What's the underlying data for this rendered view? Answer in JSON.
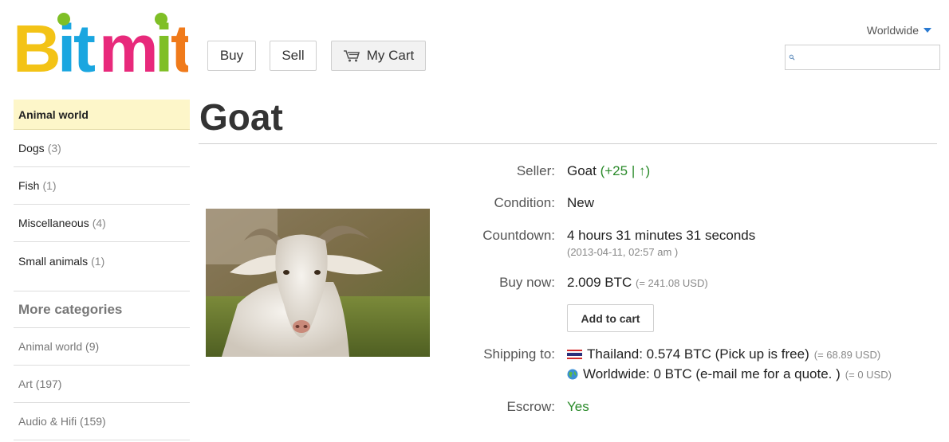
{
  "logo": {
    "text": "Bitmit"
  },
  "nav": {
    "buy_label": "Buy",
    "sell_label": "Sell",
    "cart_label": "My Cart"
  },
  "region": {
    "selected": "Worldwide"
  },
  "search": {
    "placeholder": ""
  },
  "sidebar": {
    "active_header": "Animal world",
    "subcategories": [
      {
        "label": "Dogs",
        "count": "(3)"
      },
      {
        "label": "Fish",
        "count": "(1)"
      },
      {
        "label": "Miscellaneous",
        "count": "(4)"
      },
      {
        "label": "Small animals",
        "count": "(1)"
      }
    ],
    "more_header": "More categories",
    "more_items": [
      {
        "label": "Animal world (9)"
      },
      {
        "label": "Art (197)"
      },
      {
        "label": "Audio & Hifi (159)"
      }
    ]
  },
  "product": {
    "title": "Goat",
    "seller_label": "Seller:",
    "seller_name": "Goat",
    "seller_rating": "(+25 | ↑)",
    "condition_label": "Condition:",
    "condition_value": "New",
    "countdown_label": "Countdown:",
    "countdown_value": "4 hours 31 minutes 31 seconds",
    "countdown_end": "(2013-04-11, 02:57 am )",
    "buynow_label": "Buy now:",
    "buynow_price": "2.009 BTC",
    "buynow_usd": "(= 241.08 USD)",
    "add_to_cart_label": "Add to cart",
    "shipping_label": "Shipping to:",
    "shipping": [
      {
        "icon": "thailand-flag-icon",
        "text": "Thailand: 0.574 BTC (Pick up is free)",
        "usd": "(= 68.89 USD)"
      },
      {
        "icon": "globe-icon",
        "text": "Worldwide: 0 BTC (e-mail me for a quote. )",
        "usd": "(= 0 USD)"
      }
    ],
    "escrow_label": "Escrow:",
    "escrow_value": "Yes"
  },
  "colors": {
    "accent_green": "#2a8a2a",
    "active_category_bg": "#fdf6c9",
    "caret_blue": "#2a7ad1"
  }
}
